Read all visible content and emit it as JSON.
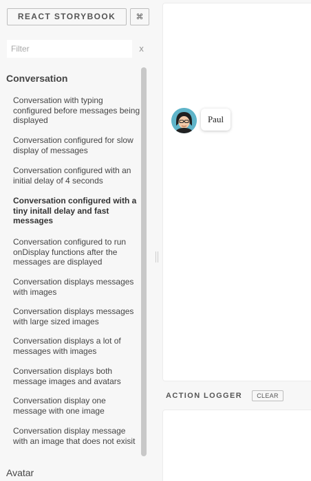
{
  "header": {
    "brand_label": "REACT STORYBOOK",
    "shortcut_label": "⌘"
  },
  "filter": {
    "placeholder": "Filter",
    "value": "",
    "clear_label": "x"
  },
  "kinds": [
    {
      "name": "Conversation",
      "stories": [
        "Conversation with typing configured before messages being displayed",
        "Conversation configured for slow display of messages",
        "Conversation configured with an initial delay of 4 seconds",
        "Conversation configured with a tiny initall delay and fast messages",
        "Conversation configured to run onDisplay functions after the messages are displayed",
        "Conversation displays messages with images",
        "Conversation displays messages with large sized images",
        "Conversation displays a lot of messages with images",
        "Conversation displays both message images and avatars",
        "Conversation display one message with one image",
        "Conversation display message with an image that does not exisit"
      ],
      "selected_index": 3
    },
    {
      "name": "Avatar",
      "stories": []
    }
  ],
  "preview": {
    "message_author": "Paul",
    "avatar_icon": "person-avatar-icon",
    "avatar_bg": "#5fb4c9"
  },
  "action_logger": {
    "title": "ACTION LOGGER",
    "clear_label": "CLEAR"
  }
}
